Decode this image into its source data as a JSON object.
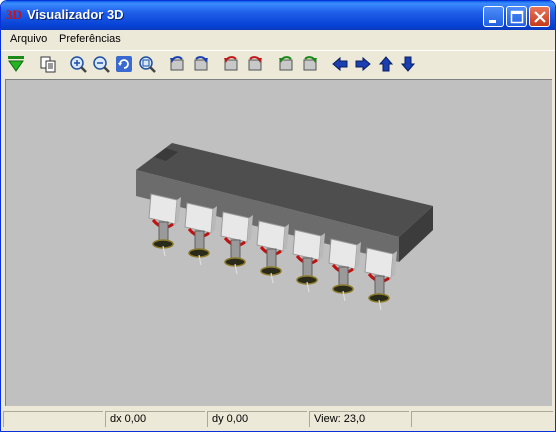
{
  "window": {
    "title": "Visualizador 3D",
    "app_icon_text": "3D"
  },
  "menu": {
    "items": [
      "Arquivo",
      "Preferências"
    ]
  },
  "toolbar": {
    "tools": [
      "arrow-down-green-icon",
      "copy-icon",
      "zoom-in-icon",
      "zoom-out-icon",
      "refresh-view-icon",
      "zoom-fit-icon",
      "rotate-left-blue-icon",
      "rotate-right-blue-icon",
      "rotate-left-red-icon",
      "rotate-right-red-icon",
      "rotate-left-green-icon",
      "rotate-right-green-icon",
      "arrow-left-icon",
      "arrow-right-icon",
      "arrow-up-icon",
      "arrow-down-icon"
    ]
  },
  "status": {
    "cell0": "",
    "dx": "dx 0,00",
    "dy": "dy 0,00",
    "view": "View: 23,0"
  },
  "colors": {
    "viewport": "#c0c0c0",
    "chip_body": "#4a4a4a",
    "pin": "#e8e8e8",
    "solder": "#c01010"
  }
}
